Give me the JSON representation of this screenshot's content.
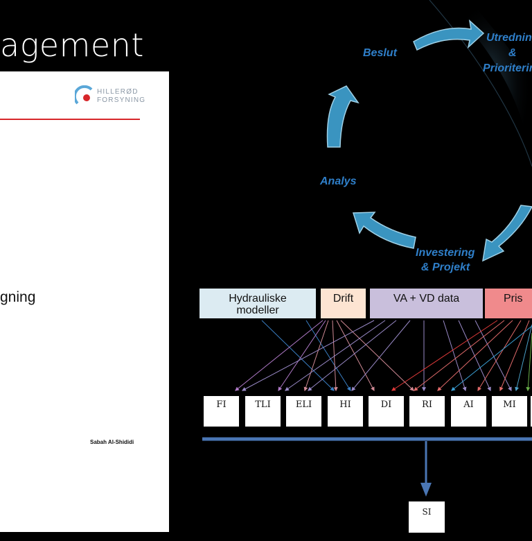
{
  "slide_title": "agement",
  "document": {
    "logo_line1": "HILLERØD",
    "logo_line2": "FORSYNING",
    "visible_text": "gning",
    "author": "Sabah Al-Shididi",
    "logo_colors": {
      "arc": "#5aa7d8",
      "dot": "#d7262a"
    }
  },
  "cycle": {
    "color": "#2f7fc9",
    "arrow_color": "#3a94c0",
    "labels": {
      "beslut": "Beslut",
      "utredning": "Utredning",
      "amp": "&",
      "prioritering": "Prioritering",
      "analys": "Analys",
      "investering": "Investering",
      "projekt": "& Projekt"
    }
  },
  "sources": [
    {
      "label_line1": "Hydrauliske",
      "label_line2": "modeller",
      "color": "#dcebf2"
    },
    {
      "label_line1": "Drift",
      "label_line2": "",
      "color": "#fde4d2"
    },
    {
      "label_line1": "VA + VD data",
      "label_line2": "",
      "color": "#c9bfdc"
    },
    {
      "label_line1": "Pris",
      "label_line2": "",
      "color": "#f08a8c"
    }
  ],
  "indicators": [
    "FI",
    "TLI",
    "ELI",
    "HI",
    "DI",
    "RI",
    "AI",
    "MI"
  ],
  "summary": "SI",
  "bus_color": "#4a76b4"
}
